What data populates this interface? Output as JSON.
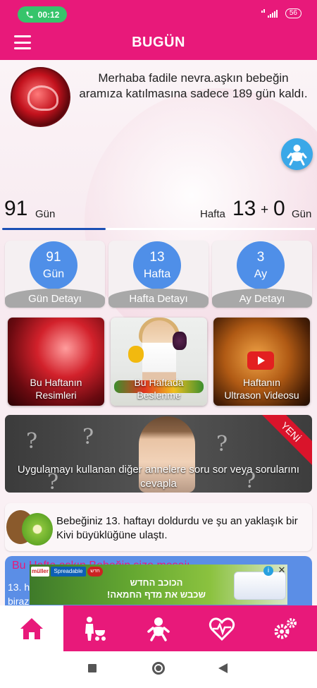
{
  "status_bar": {
    "call_time": "00:12",
    "battery": "56"
  },
  "app_bar": {
    "title": "BUGÜN"
  },
  "greeting": "Merhaba fadile nevra.aşkın bebeğin aramıza katılmasına sadece 189 gün kaldı.",
  "counter": {
    "days": "91",
    "days_unit": "Gün",
    "week_label": "Hafta",
    "weeks": "13",
    "plus": "+",
    "week_days": "0",
    "week_days_unit": "Gün",
    "progress_fraction": 0.33
  },
  "stats": [
    {
      "value": "91",
      "unit": "Gün",
      "label": "Gün Detayı"
    },
    {
      "value": "13",
      "unit": "Hafta",
      "label": "Hafta Detayı"
    },
    {
      "value": "3",
      "unit": "Ay",
      "label": "Ay Detayı"
    }
  ],
  "photo_cards": [
    {
      "line1": "Bu Haftanın",
      "line2": "Resimleri"
    },
    {
      "line1": "Bu Haftada",
      "line2": "Beslenme"
    },
    {
      "line1": "Haftanın",
      "line2": "Ultrason Videosu"
    }
  ],
  "banner": {
    "ribbon": "YENİ",
    "text": "Uygulamayı kullanan diğer annelere soru sor veya sorularını cevapla"
  },
  "info_card": {
    "text": "Bebeğiniz 13. haftayı doldurdu ve şu an yaklaşık bir Kivi büyüklüğüne ulaştı."
  },
  "message_card": {
    "title": "Bu Hafta aşkın Bebeğin size mesajı",
    "line1": "13. h",
    "line2": "biraz"
  },
  "ad": {
    "brand": "müller",
    "tag": "Spreadable",
    "tag2": "חדש",
    "line1": "הכוכב החדש",
    "line2": "שכבש את מדף החמאה!",
    "info": "i",
    "close": "✕"
  },
  "colors": {
    "primary": "#e8197a",
    "stat_circle": "#4f8fe8",
    "progress": "#1b4fb4",
    "fab": "#3aa8e8",
    "message_card": "#5b8ee6"
  },
  "bottom_nav": [
    {
      "icon": "home-icon",
      "active": true
    },
    {
      "icon": "mother-stroller-icon",
      "active": false
    },
    {
      "icon": "baby-icon",
      "active": false
    },
    {
      "icon": "heart-pulse-icon",
      "active": false
    },
    {
      "icon": "gears-icon",
      "active": false
    }
  ]
}
